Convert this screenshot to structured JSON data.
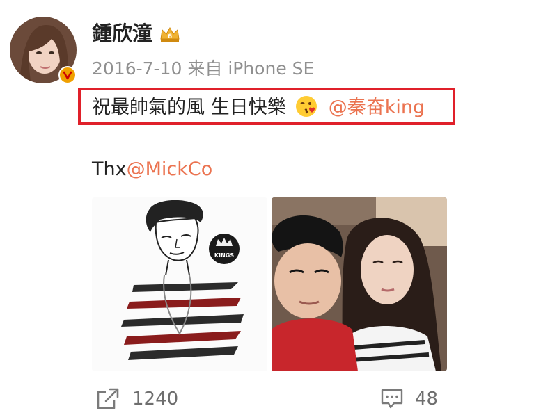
{
  "post": {
    "author": "鍾欣潼",
    "timestamp": "2016-7-10",
    "source_prefix": "来自",
    "device": "iPhone SE",
    "text": "祝最帥氣的風 生日快樂",
    "mention": "@秦奋king",
    "thx_prefix": "Thx",
    "thx_mention": "@MickCo"
  },
  "images": [
    {
      "icon": "illustration",
      "badge_text": "KINGS"
    },
    {
      "icon": "selfie-photo"
    }
  ],
  "actions": {
    "share_count": "1240",
    "comment_count": "48"
  },
  "colors": {
    "mention": "#eb7350",
    "highlight_border": "#e0202a",
    "verified_badge": "#f0a000",
    "meta_text": "#909090"
  }
}
